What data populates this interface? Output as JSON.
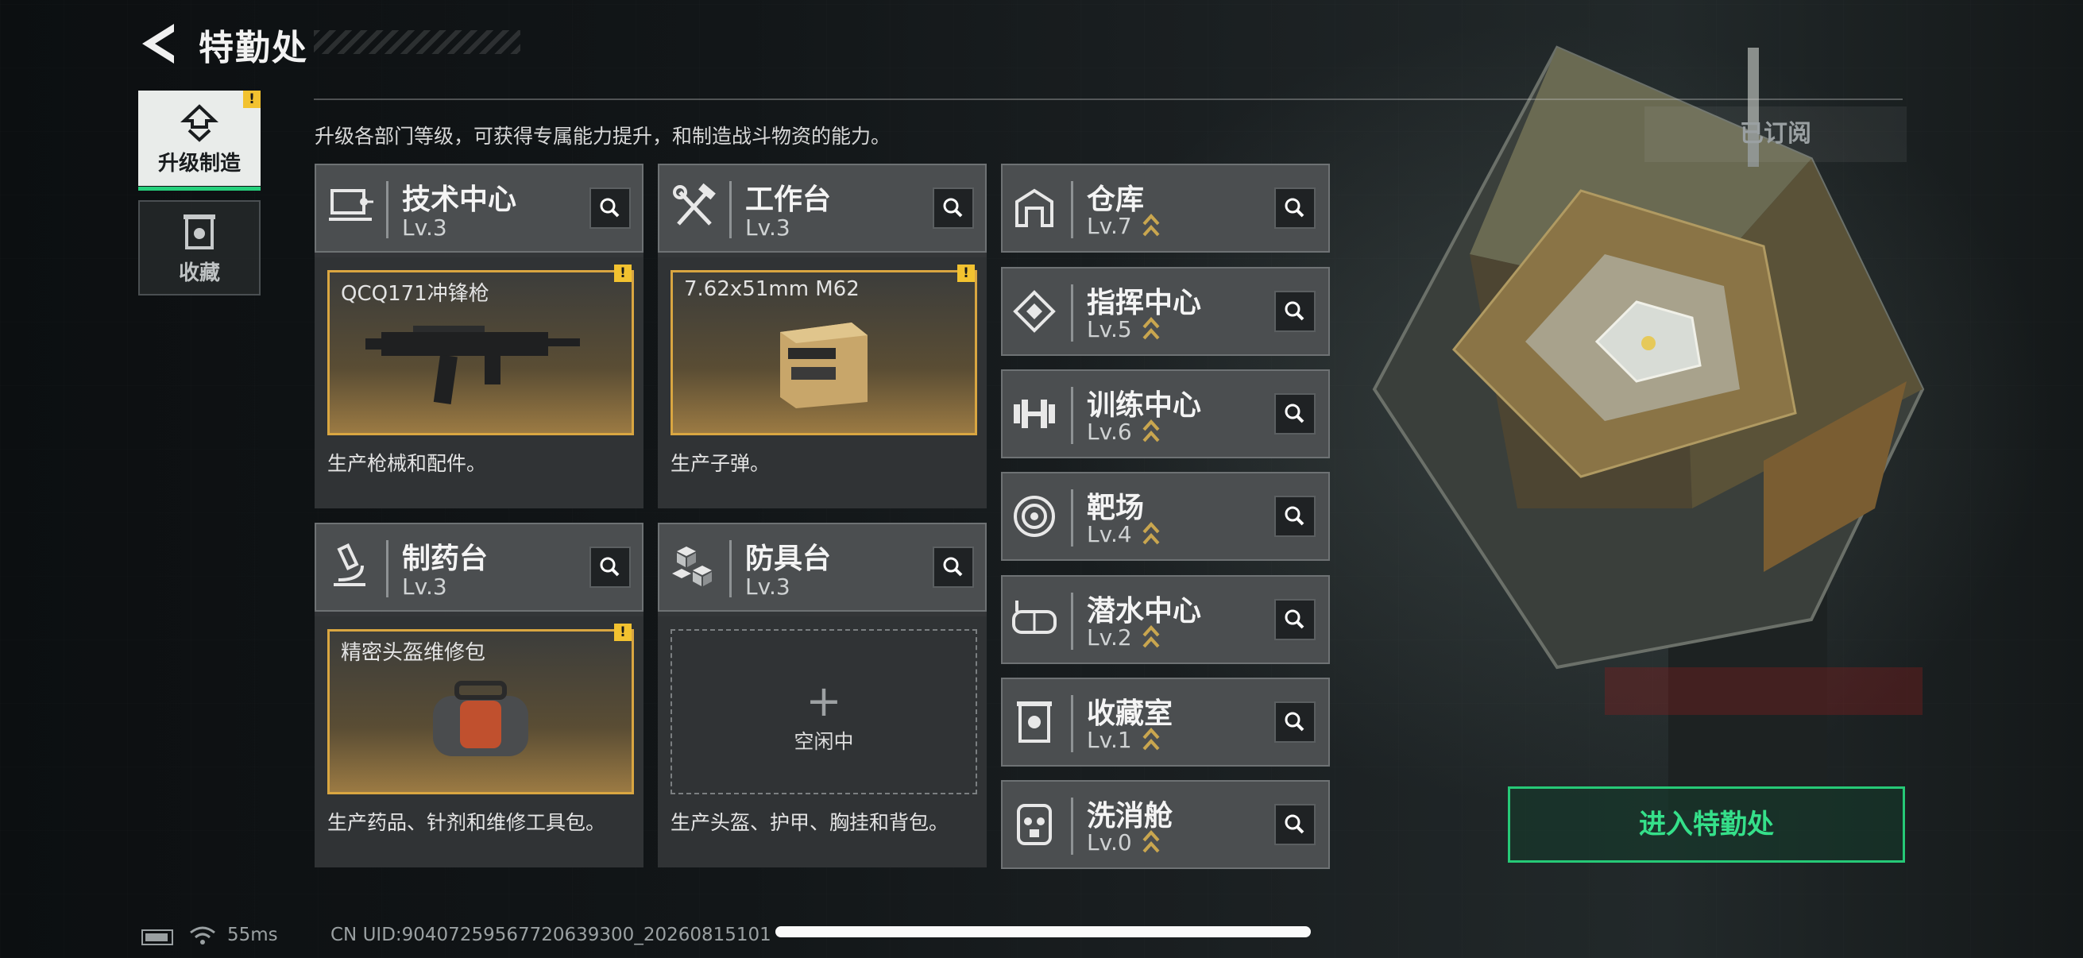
{
  "header": {
    "title": "特勤处"
  },
  "nav": [
    {
      "label": "升级制造",
      "active": true,
      "warning": "!"
    },
    {
      "label": "收藏",
      "active": false
    }
  ],
  "subtitle": "升级各部门等级，可获得专属能力提升，和制造战斗物资的能力。",
  "subscribed_label": "已订阅",
  "departments": [
    {
      "name": "技术中心",
      "level": "Lv.3",
      "icon": "circuit-board-icon",
      "slot": {
        "name": "QCQ171冲锋枪",
        "warning": "!",
        "item_icon": "smg-icon"
      },
      "desc": "生产枪械和配件。"
    },
    {
      "name": "工作台",
      "level": "Lv.3",
      "icon": "tools-icon",
      "slot": {
        "name": "7.62x51mm M62",
        "warning": "!",
        "item_icon": "ammo-box-icon"
      },
      "desc": "生产子弹。"
    },
    {
      "name": "制药台",
      "level": "Lv.3",
      "icon": "microscope-icon",
      "slot": {
        "name": "精密头盔维修包",
        "warning": "!",
        "item_icon": "repair-kit-icon"
      },
      "desc": "生产药品、针剂和维修工具包。"
    },
    {
      "name": "防具台",
      "level": "Lv.3",
      "icon": "cubes-icon",
      "slot": {
        "idle_label": "空闲中"
      },
      "desc": "生产头盔、护甲、胸挂和背包。"
    }
  ],
  "facilities": [
    {
      "name": "仓库",
      "level": "Lv.7",
      "icon": "warehouse-icon"
    },
    {
      "name": "指挥中心",
      "level": "Lv.5",
      "icon": "command-diamond-icon"
    },
    {
      "name": "训练中心",
      "level": "Lv.6",
      "icon": "dumbbell-icon"
    },
    {
      "name": "靶场",
      "level": "Lv.4",
      "icon": "target-icon"
    },
    {
      "name": "潜水中心",
      "level": "Lv.2",
      "icon": "diving-mask-icon"
    },
    {
      "name": "收藏室",
      "level": "Lv.1",
      "icon": "trophy-case-icon"
    },
    {
      "name": "洗消舱",
      "level": "Lv.0",
      "icon": "hazmat-icon"
    }
  ],
  "enter_button": "进入特勤处",
  "status": {
    "ping": "55ms",
    "uid": "CN UID:90407259567720639300_20260815101"
  },
  "colors": {
    "accent": "#26d07c",
    "warning": "#f2c230",
    "slot_border": "#d9a641"
  }
}
